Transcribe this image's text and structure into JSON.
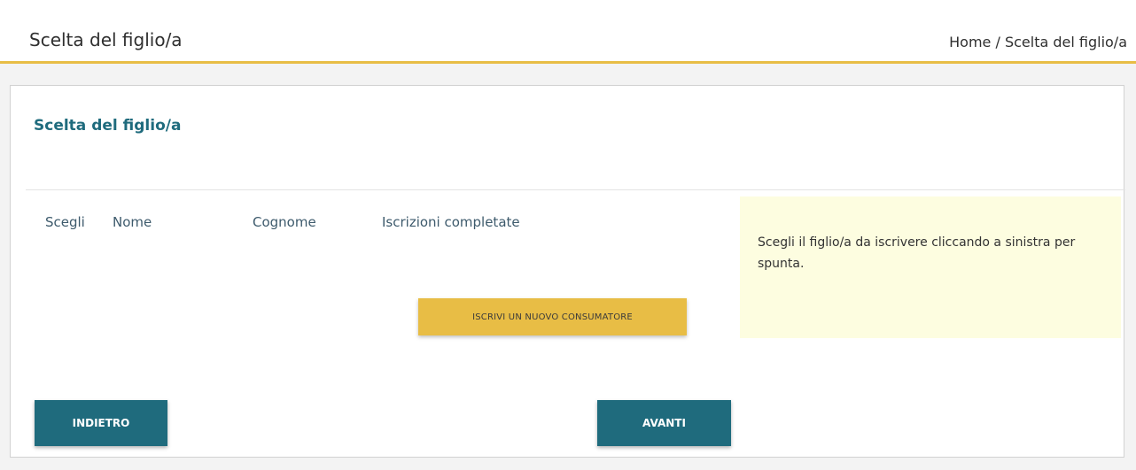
{
  "header": {
    "title": "Scelta del figlio/a",
    "breadcrumb": {
      "home": "Home",
      "separator": " / ",
      "current": "Scelta del figlio/a"
    }
  },
  "card": {
    "title": "Scelta del figlio/a",
    "table": {
      "columns": [
        "Scegli",
        "Nome",
        "Cognome",
        "Iscrizioni completate"
      ],
      "rows": []
    },
    "hint": "Scegli il figlio/a da iscrivere cliccando a sinistra per spunta.",
    "add_button_label": "ISCRIVI UN NUOVO CONSUMATORE",
    "back_button_label": "INDIETRO",
    "next_button_label": "AVANTI"
  },
  "colors": {
    "accent_yellow": "#e8bd45",
    "primary_teal": "#1f6b7d",
    "hint_background": "#fdfde0",
    "content_background": "#f3f3f3"
  }
}
